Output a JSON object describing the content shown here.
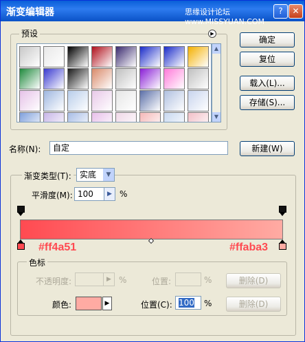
{
  "window": {
    "title": "渐变编辑器",
    "watermark": "思缘设计论坛 www.MISSYUAN.COM"
  },
  "titlebar_buttons": {
    "help": "?",
    "close": "✕"
  },
  "presets": {
    "label": "预设",
    "menu_icon": "play-circle-icon",
    "swatches": [
      [
        "#c8c8c8",
        "#e8e8e8",
        "#000000",
        "#b0101c",
        "#3a2a6e",
        "#1b2cc9",
        "#1b2cc9",
        "#f4b000"
      ],
      [
        "#1f8a3d",
        "#3a3ad0",
        "#1a1a1a",
        "#d98a6a",
        "#c0c0c0",
        "#8a1fd6",
        "#ff7ad9",
        "#c0c0c0"
      ],
      [
        "#e6c2e8",
        "#9fb7e0",
        "#b8cdea",
        "#e8c8e8",
        "#e6e6e6",
        "#5b6fa8",
        "#b0c0e0",
        "#c8d4ee"
      ],
      [
        "#7fa0dc",
        "#c8b6e8",
        "#a8bde6",
        "#e8c0ea",
        "#f0d8e8",
        "#f5b8b8",
        "#c8d8f0",
        "#f2c0c8"
      ]
    ]
  },
  "buttons": {
    "ok": "确定",
    "reset": "复位",
    "load": "载入(L)...",
    "save": "存储(S)...",
    "new": "新建(W)"
  },
  "name": {
    "label": "名称(N):",
    "value": "自定"
  },
  "gradient_type": {
    "label": "渐变类型(T):",
    "value": "实底"
  },
  "smoothness": {
    "label": "平滑度(M):",
    "value": "100",
    "unit": "%"
  },
  "gradient": {
    "start_color": "#ff4a51",
    "end_color": "#ffaba3",
    "start_label": "#ff4a51",
    "end_label": "#ffaba3"
  },
  "stops_group": {
    "label": "色标",
    "opacity_label": "不透明度:",
    "opacity_unit": "%",
    "opacity_location_label": "位置:",
    "opacity_location_unit": "%",
    "delete_label": "删除(D)",
    "color_label": "颜色:",
    "color_value": "#ffaba3",
    "color_location_label": "位置(C):",
    "color_location_value": "100",
    "color_location_unit": "%"
  }
}
